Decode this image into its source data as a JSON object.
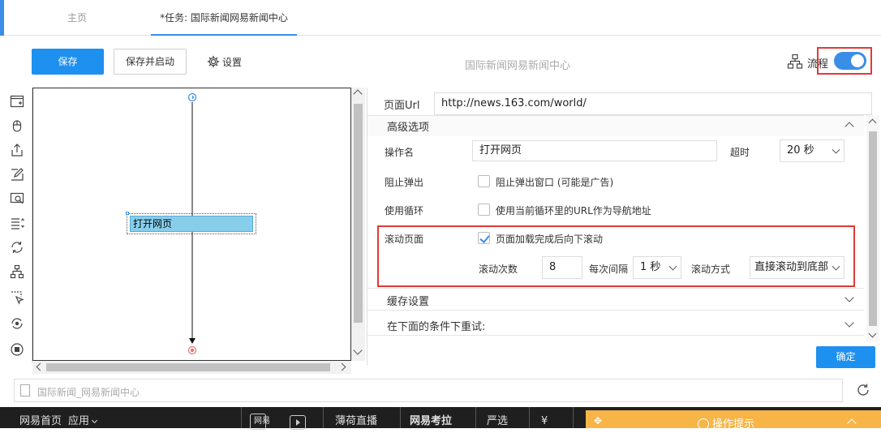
{
  "tabs": [
    {
      "label": "主页"
    },
    {
      "label": "*任务: 国际新闻网易新闻中心"
    }
  ],
  "toolbar": {
    "save_label": "保存",
    "save_start_label": "保存并启动",
    "settings_label": "设置",
    "title": "国际新闻网易新闻中心",
    "flow_label": "流程"
  },
  "canvas": {
    "node_label": "打开网页"
  },
  "panel": {
    "url_label": "页面Url",
    "url_value": "http://news.163.com/world/",
    "advanced_label": "高级选项",
    "op_name_label": "操作名",
    "op_name_value": "打开网页",
    "timeout_label": "超时",
    "timeout_value": "20 秒",
    "block_popup_label": "阻止弹出",
    "block_popup_check": "阻止弹出窗口 (可能是广告)",
    "loop_label": "使用循环",
    "loop_check": "使用当前循环里的URL作为导航地址",
    "scroll_label": "滚动页面",
    "scroll_check": "页面加载完成后向下滚动",
    "scroll_count_label": "滚动次数",
    "scroll_count_value": "8",
    "interval_label": "每次间隔",
    "interval_value": "1 秒",
    "scroll_mode_label": "滚动方式",
    "scroll_mode_value": "直接滚动到底部",
    "cache_label": "缓存设置",
    "retry_label": "在下面的条件下重试:",
    "confirm_label": "确定"
  },
  "browser": {
    "url_placeholder": "国际新闻_网易新闻中心"
  },
  "taskbar": {
    "items": [
      "网易首页",
      "应用",
      "网易",
      "",
      "薄荷直播",
      "网易考拉",
      "严选",
      "¥",
      ""
    ],
    "hint": "操作提示"
  },
  "colors": {
    "accent": "#1e90f0",
    "highlight": "#e53935",
    "node_fill": "#87ceeb",
    "hint_bg": "#f7b548"
  }
}
